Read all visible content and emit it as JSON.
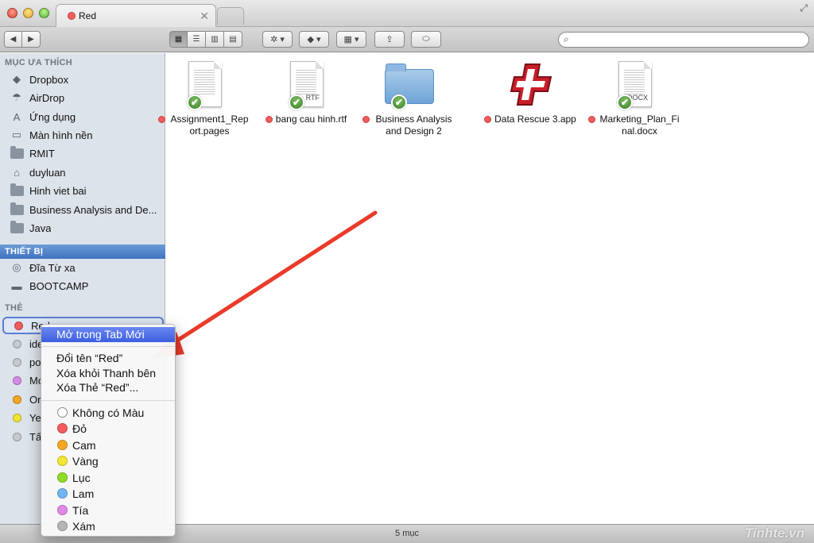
{
  "colors": {
    "tag_red": "#f25c5c",
    "tag_gray": "#c6c9ce",
    "tag_purple": "#d98ae6",
    "tag_orange": "#f5a623",
    "tag_yellow": "#f3e531",
    "tag_green": "#8fdc2b",
    "tag_blue": "#6fb6f2",
    "tag_violet": "#e089e8",
    "tag_none_gray": "#b5b5b5",
    "highlight": "#3d5ee0",
    "annotation_arrow": "#ea3b2a"
  },
  "window": {
    "tab_title": "Red",
    "tab_close": "✕",
    "fullscreen": "⤢"
  },
  "toolbar": {
    "back": "◀",
    "forward": "▶",
    "view_icon": "▦",
    "view_list": "☰",
    "view_column": "▥",
    "view_coverflow": "▤",
    "action": "✲ ▾",
    "dropbox": "◆ ▾",
    "arrange": "▦ ▾",
    "share": "⇪",
    "tags_btn": "⬭",
    "search_icon": "⌕",
    "search_placeholder": ""
  },
  "sidebar": {
    "favorites_header": "MỤC ƯA THÍCH",
    "favorites": [
      {
        "label": "Dropbox",
        "icon": "dropbox-icon",
        "glyph": "◆"
      },
      {
        "label": "AirDrop",
        "icon": "airdrop-icon",
        "glyph": "☂"
      },
      {
        "label": "Ứng dụng",
        "icon": "applications-icon",
        "glyph": "A"
      },
      {
        "label": "Màn hình nền",
        "icon": "desktop-icon",
        "glyph": "▭"
      },
      {
        "label": "RMIT",
        "icon": "folder-icon"
      },
      {
        "label": "duyluan",
        "icon": "home-icon",
        "glyph": "⌂"
      },
      {
        "label": "Hinh viet bai",
        "icon": "folder-icon"
      },
      {
        "label": "Business Analysis and De...",
        "icon": "folder-icon"
      },
      {
        "label": "Java",
        "icon": "folder-icon"
      }
    ],
    "devices_header": "THIẾT BỊ",
    "devices": [
      {
        "label": "Đĩa Từ xa",
        "icon": "remote-disc-icon",
        "glyph": "◎"
      },
      {
        "label": "BOOTCAMP",
        "icon": "hard-drive-icon",
        "glyph": "▬"
      }
    ],
    "tags_header": "THẺ",
    "tags": [
      {
        "label": "Red",
        "color": "#f25c5c"
      },
      {
        "label": "ide",
        "color": "#c6c9ce"
      },
      {
        "label": "po",
        "color": "#c6c9ce"
      },
      {
        "label": "Mo",
        "color": "#d98ae6"
      },
      {
        "label": "Or",
        "color": "#f5a623"
      },
      {
        "label": "Ye",
        "color": "#f3e531"
      },
      {
        "label": "Tấ",
        "color": "#c6c9ce"
      }
    ]
  },
  "files": [
    {
      "name": "Assignment1_Report.pages",
      "kind": "doc",
      "ext": "",
      "synced": true
    },
    {
      "name": "bang cau hinh.rtf",
      "kind": "doc",
      "ext": "RTF",
      "synced": true
    },
    {
      "name": "Business Analysis and Design 2",
      "kind": "folder",
      "ext": "",
      "synced": true
    },
    {
      "name": "Data Rescue 3.app",
      "kind": "app",
      "ext": "",
      "synced": false
    },
    {
      "name": "Marketing_Plan_Final.docx",
      "kind": "doc",
      "ext": "DOCX",
      "synced": true
    }
  ],
  "check_glyph": "✔",
  "context_menu": {
    "open_new_tab": "Mở trong Tab Mới",
    "rename": "Đổi tên “Red”",
    "remove_sidebar": "Xóa khỏi Thanh bên",
    "delete_tag": "Xóa Thẻ “Red”...",
    "colors": [
      {
        "label": "Không có Màu",
        "color": "#ffffff"
      },
      {
        "label": "Đỏ",
        "color": "#f25c5c"
      },
      {
        "label": "Cam",
        "color": "#f5a623"
      },
      {
        "label": "Vàng",
        "color": "#f3e531"
      },
      {
        "label": "Lục",
        "color": "#8fdc2b"
      },
      {
        "label": "Lam",
        "color": "#6fb6f2"
      },
      {
        "label": "Tía",
        "color": "#e089e8"
      },
      {
        "label": "Xám",
        "color": "#b5b5b5"
      }
    ]
  },
  "status": {
    "item_count": "5 mục",
    "watermark": "Tinhte.vn"
  }
}
